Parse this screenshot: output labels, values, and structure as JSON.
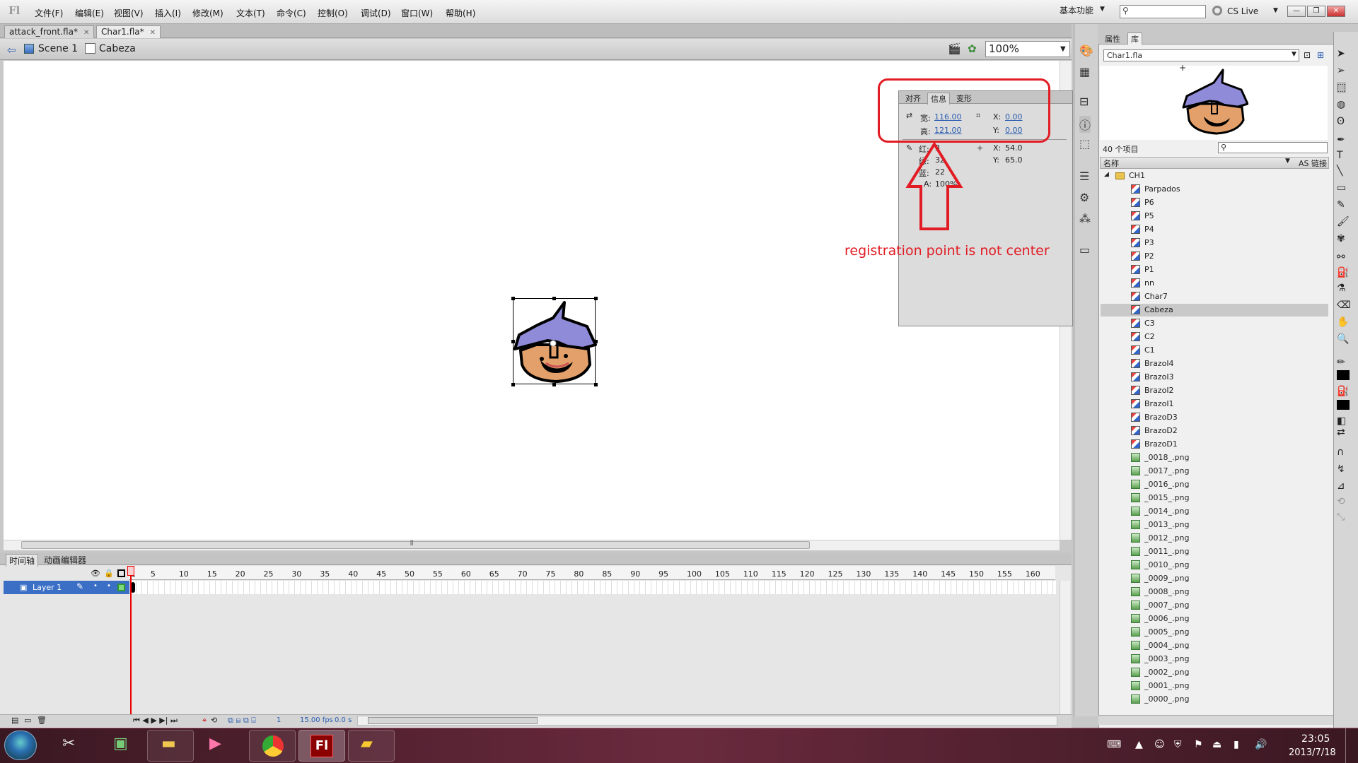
{
  "app": {
    "logo": "Fl"
  },
  "menu": [
    "文件(F)",
    "编辑(E)",
    "视图(V)",
    "插入(I)",
    "修改(M)",
    "文本(T)",
    "命令(C)",
    "控制(O)",
    "调试(D)",
    "窗口(W)",
    "帮助(H)"
  ],
  "workspace": "基本功能",
  "cslive": "CS Live",
  "window_controls": {
    "minimize": "—",
    "restore": "❐",
    "close": "✕"
  },
  "doc_tabs": [
    {
      "label": "attack_front.fla*",
      "close": "✕"
    },
    {
      "label": "Char1.fla*",
      "close": "✕"
    }
  ],
  "edit_bar": {
    "scene": "Scene 1",
    "symbol": "Cabeza",
    "zoom": "100%"
  },
  "info_panel": {
    "tabs": [
      "对齐",
      "信息",
      "变形"
    ],
    "width_label": "宽:",
    "width": "116.00",
    "height_label": "高:",
    "height": "121.00",
    "x_label": "X:",
    "x": "0.00",
    "y_label": "Y:",
    "y": "0.00",
    "r_label": "红:",
    "r": "3",
    "g_label": "绿:",
    "g": "32",
    "b_label": "蓝:",
    "b": "22",
    "a_label": "A:",
    "a": "100%",
    "cursor_x_label": "X:",
    "cursor_x": "54.0",
    "cursor_y_label": "Y:",
    "cursor_y": "65.0"
  },
  "annotation": "registration point is not center",
  "library": {
    "tabs": [
      "属性",
      "库"
    ],
    "file": "Char1.fla",
    "count": "40 个项目",
    "col_name": "名称",
    "col_link": "AS 链接",
    "items": [
      {
        "name": "CH1",
        "type": "folder"
      },
      {
        "name": "Parpados",
        "type": "symbol"
      },
      {
        "name": "P6",
        "type": "symbol"
      },
      {
        "name": "P5",
        "type": "symbol"
      },
      {
        "name": "P4",
        "type": "symbol"
      },
      {
        "name": "P3",
        "type": "symbol"
      },
      {
        "name": "P2",
        "type": "symbol"
      },
      {
        "name": "P1",
        "type": "symbol"
      },
      {
        "name": "nn",
        "type": "symbol"
      },
      {
        "name": "Char7",
        "type": "symbol"
      },
      {
        "name": "Cabeza",
        "type": "symbol",
        "selected": true
      },
      {
        "name": "C3",
        "type": "symbol"
      },
      {
        "name": "C2",
        "type": "symbol"
      },
      {
        "name": "C1",
        "type": "symbol"
      },
      {
        "name": "BrazoI4",
        "type": "symbol"
      },
      {
        "name": "BrazoI3",
        "type": "symbol"
      },
      {
        "name": "BrazoI2",
        "type": "symbol"
      },
      {
        "name": "BrazoI1",
        "type": "symbol"
      },
      {
        "name": "BrazoD3",
        "type": "symbol"
      },
      {
        "name": "BrazoD2",
        "type": "symbol"
      },
      {
        "name": "BrazoD1",
        "type": "symbol"
      },
      {
        "name": "_0018_.png",
        "type": "image"
      },
      {
        "name": "_0017_.png",
        "type": "image"
      },
      {
        "name": "_0016_.png",
        "type": "image"
      },
      {
        "name": "_0015_.png",
        "type": "image"
      },
      {
        "name": "_0014_.png",
        "type": "image"
      },
      {
        "name": "_0013_.png",
        "type": "image"
      },
      {
        "name": "_0012_.png",
        "type": "image"
      },
      {
        "name": "_0011_.png",
        "type": "image"
      },
      {
        "name": "_0010_.png",
        "type": "image"
      },
      {
        "name": "_0009_.png",
        "type": "image"
      },
      {
        "name": "_0008_.png",
        "type": "image"
      },
      {
        "name": "_0007_.png",
        "type": "image"
      },
      {
        "name": "_0006_.png",
        "type": "image"
      },
      {
        "name": "_0005_.png",
        "type": "image"
      },
      {
        "name": "_0004_.png",
        "type": "image"
      },
      {
        "name": "_0003_.png",
        "type": "image"
      },
      {
        "name": "_0002_.png",
        "type": "image"
      },
      {
        "name": "_0001_.png",
        "type": "image"
      },
      {
        "name": "_0000_.png",
        "type": "image"
      }
    ]
  },
  "timeline": {
    "tabs": [
      "时间轴",
      "动画编辑器"
    ],
    "ticks": [
      "1",
      "5",
      "10",
      "15",
      "20",
      "25",
      "30",
      "35",
      "40",
      "45",
      "50",
      "55",
      "60",
      "65",
      "70",
      "75",
      "80",
      "85",
      "90",
      "95",
      "100",
      "105",
      "110",
      "115",
      "120",
      "125",
      "130",
      "135",
      "140",
      "145",
      "150",
      "155",
      "160"
    ],
    "layer": "Layer 1",
    "current_frame": "1",
    "fps": "15.00 fps",
    "time": "0.0 s"
  },
  "clock": {
    "time": "23:05",
    "date": "2013/7/18"
  }
}
